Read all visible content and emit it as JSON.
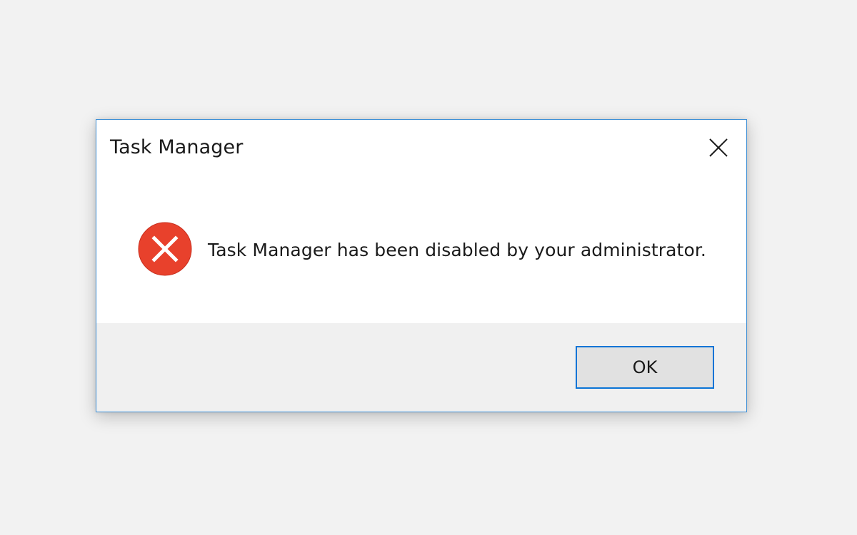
{
  "dialog": {
    "title": "Task Manager",
    "message": "Task Manager has been disabled by your administrator.",
    "ok_label": "OK",
    "icons": {
      "close": "close-icon",
      "error": "error-icon"
    }
  },
  "colors": {
    "background": "#f2f2f2",
    "dialog_border": "#3d8fd6",
    "error_red": "#e8412c",
    "button_focus_border": "#0a74d6",
    "button_face": "#e1e1e1",
    "footer": "#f0f0f0"
  }
}
